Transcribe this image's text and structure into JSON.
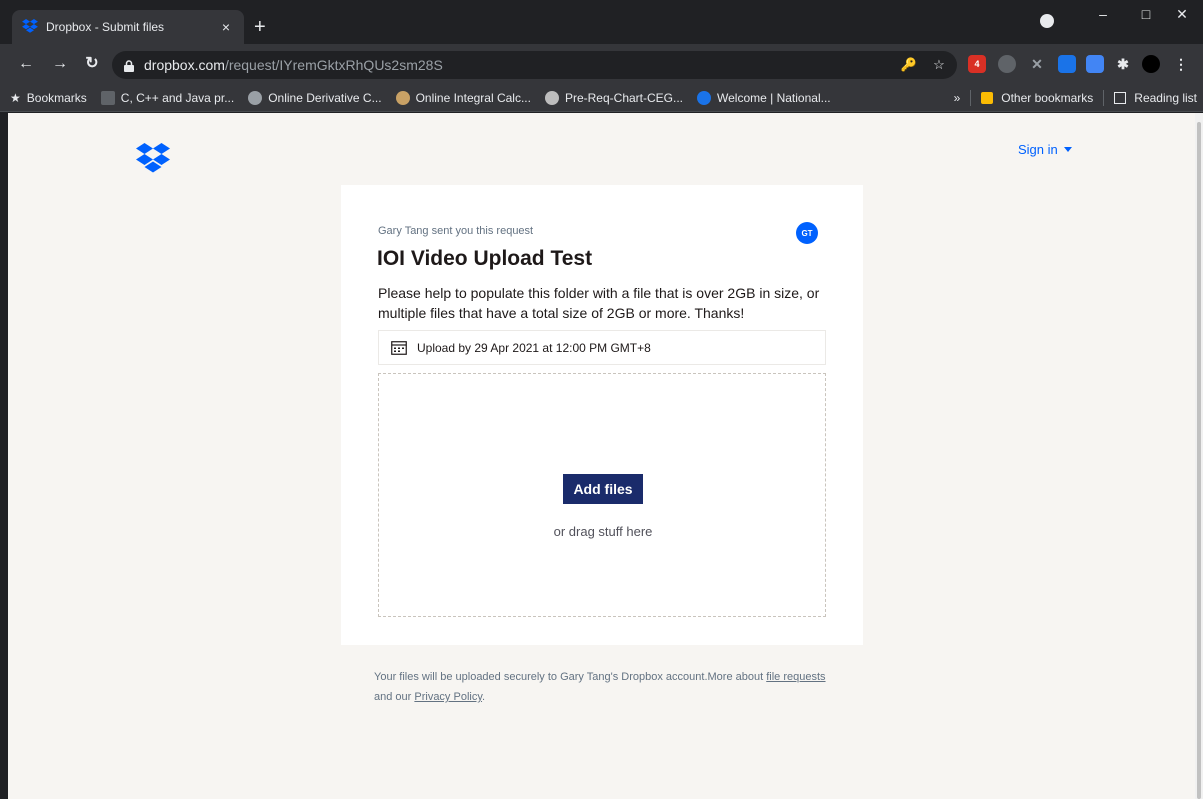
{
  "browser": {
    "tab_title": "Dropbox - Submit files",
    "tab_close": "×",
    "new_tab": "+",
    "url_host": "dropbox.com",
    "url_path": "/request/IYremGktxRhQUs2sm28S",
    "ext_badge": "4",
    "bookmarks": [
      {
        "label": "Bookmarks",
        "icon": "star-icon"
      },
      {
        "label": "C, C++ and Java pr...",
        "icon": "code-icon"
      },
      {
        "label": "Online Derivative C...",
        "icon": "globe-icon"
      },
      {
        "label": "Online Integral Calc...",
        "icon": "globe-icon"
      },
      {
        "label": "Pre-Req-Chart-CEG...",
        "icon": "crest-icon"
      },
      {
        "label": "Welcome | National...",
        "icon": "site-icon"
      }
    ],
    "more_bookmarks": "»",
    "other_bookmarks": "Other bookmarks",
    "reading_list": "Reading list"
  },
  "header": {
    "sign_in": "Sign in"
  },
  "request": {
    "requester_text": "Gary Tang sent you this request",
    "avatar_initials": "GT",
    "title": "IOI Video Upload Test",
    "description": "Please help to populate this folder with a file that is over 2GB in size, or multiple files that have a total size of 2GB or more. Thanks!",
    "deadline": "Upload by 29 Apr 2021 at 12:00 PM GMT+8",
    "add_files": "Add files",
    "drag_text": "or drag stuff here"
  },
  "footer": {
    "text_before": "Your files will be uploaded securely to Gary Tang's Dropbox account.More about ",
    "link_file_requests": "file requests",
    "text_mid": " and our ",
    "link_privacy": "Privacy Policy",
    "text_end": "."
  },
  "colors": {
    "brand_blue": "#0061fe",
    "button_navy": "#1a2b6b",
    "page_bg": "#f7f5f2"
  }
}
